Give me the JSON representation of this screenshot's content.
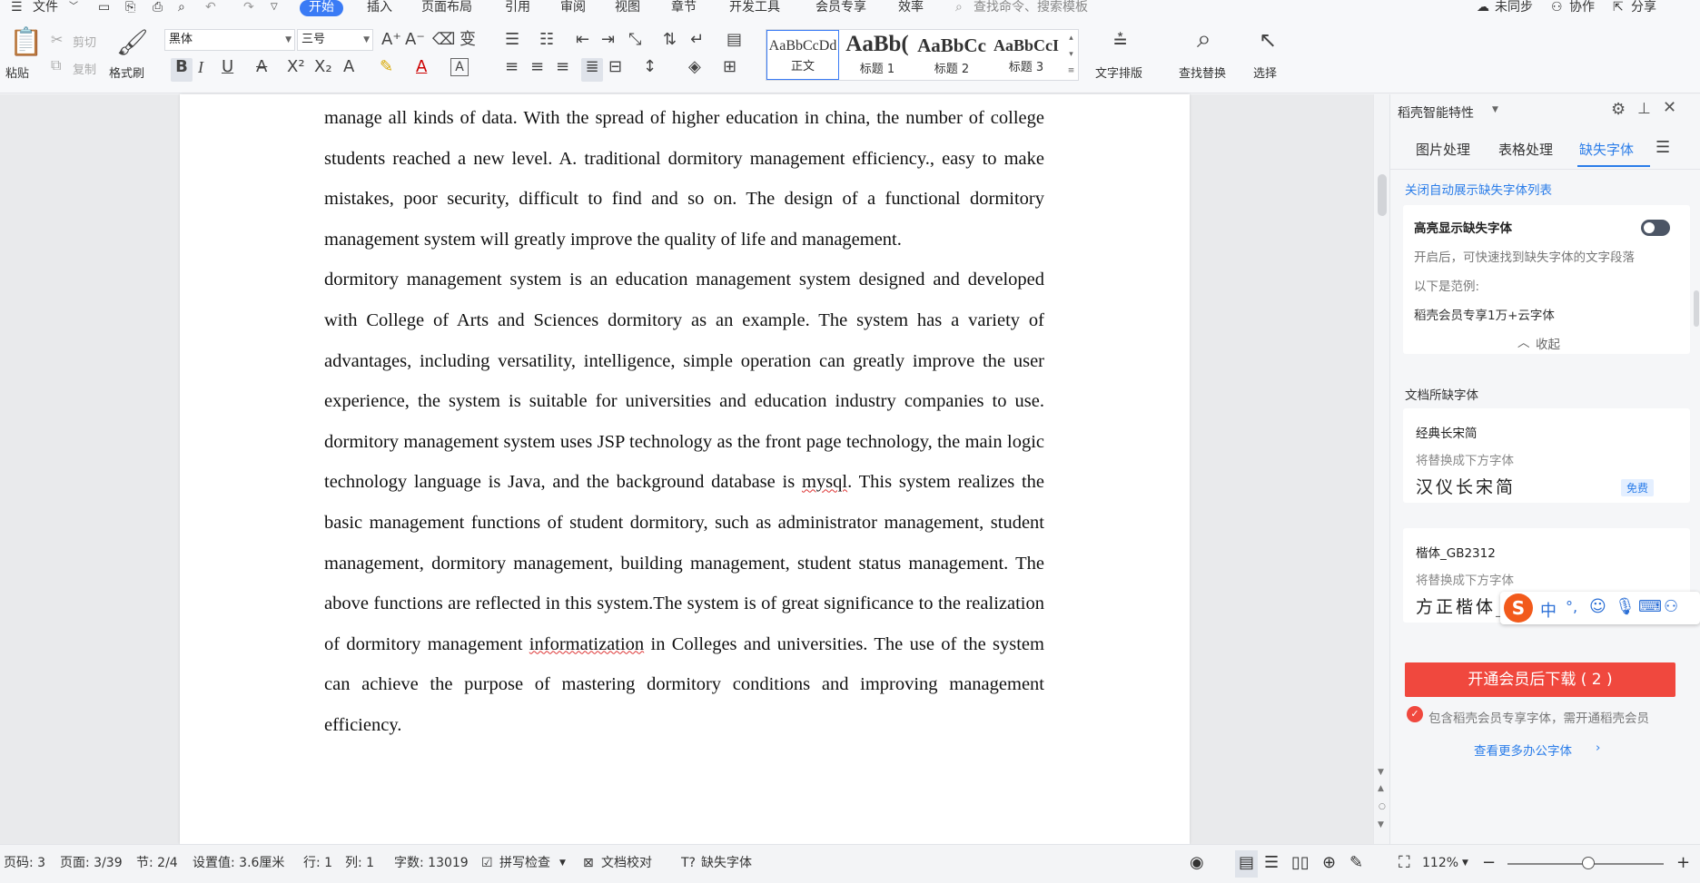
{
  "menu": {
    "file": "文件",
    "tabs": [
      "开始",
      "插入",
      "页面布局",
      "引用",
      "审阅",
      "视图",
      "章节",
      "开发工具",
      "会员专享",
      "效率"
    ],
    "search_placeholder": "查找命令、搜索模板",
    "sync": "未同步",
    "collab": "协作",
    "share": "分享"
  },
  "ribbon": {
    "paste": "粘贴",
    "cut": "剪切",
    "copy": "复制",
    "format_painter": "格式刷",
    "font_name": "黑体",
    "font_size": "三号",
    "styles": [
      {
        "sample": "AaBbCcDd",
        "name": "正文"
      },
      {
        "sample": "AaBb(",
        "name": "标题 1"
      },
      {
        "sample": "AaBbCc",
        "name": "标题 2"
      },
      {
        "sample": "AaBbCcI",
        "name": "标题 3"
      }
    ],
    "text_layout": "文字排版",
    "find_replace": "查找替换",
    "select": "选择"
  },
  "document": {
    "paragraphs": [
      "manage all kinds of data. With the spread of higher education in china, the number of college students reached a new level. A. traditional dormitory management efficiency., easy to make mistakes, poor security, difficult to find and so on. The design of a functional dormitory management system will greatly improve the quality of life and management.",
      " dormitory management system is an education management system designed and developed with   College of Arts and Sciences dormitory as an example. The system has a variety of advantages, including versatility, intelligence, simple operation can greatly improve the user experience, the system is suitable for universities and education industry companies to use.   dormitory management system uses JSP technology as the front page technology, the main logic technology language is Java, and the background database is ",
      "mysql",
      ". This system realizes the basic management functions of student dormitory, such as administrator management, student management, dormitory management, building management, student status management. The above functions are reflected in this system.The system is of great significance to the realization of dormitory management ",
      "informatization",
      " in Colleges and universities. The use of the system can achieve the purpose of mastering dormitory conditions and improving management efficiency."
    ]
  },
  "panel": {
    "title": "稻壳智能特性",
    "tabs": [
      "图片处理",
      "表格处理",
      "缺失字体"
    ],
    "close_auto": "关闭自动展示缺失字体列表",
    "highlight_title": "高亮显示缺失字体",
    "highlight_desc": "开启后，可快速找到缺失字体的文字段落",
    "example_label": "以下是范例:",
    "example_text": "稻壳会员专享1万+云字体",
    "collapse": "收起",
    "missing_header": "文档所缺字体",
    "fonts": [
      {
        "name": "经典长宋简",
        "replace": "将替换成下方字体",
        "preview": "汉仪长宋简",
        "badge": "免费"
      },
      {
        "name": "楷体_GB2312",
        "replace": "将替换成下方字体",
        "preview": "方正楷体_G",
        "badge": ""
      }
    ],
    "download_button": "开通会员后下载 ( 2 )",
    "note": "包含稻壳会员专享字体，需开通稻壳会员",
    "more_link": "查看更多办公字体"
  },
  "status": {
    "page_code": "页码: 3",
    "page": "页面: 3/39",
    "section": "节: 2/4",
    "setting": "设置值: 3.6厘米",
    "row": "行: 1",
    "col": "列: 1",
    "word_count": "字数: 13019",
    "spell_check": "拼写检查",
    "doc_proof": "文档校对",
    "missing_font": "缺失字体",
    "zoom": "112%",
    "zoom_level_percent": 112
  },
  "ime": {
    "mode": "中",
    "punct": "°,"
  },
  "colors": {
    "accent": "#3a7bf5",
    "download_btn": "#f0483e",
    "link": "#2b7de9"
  }
}
